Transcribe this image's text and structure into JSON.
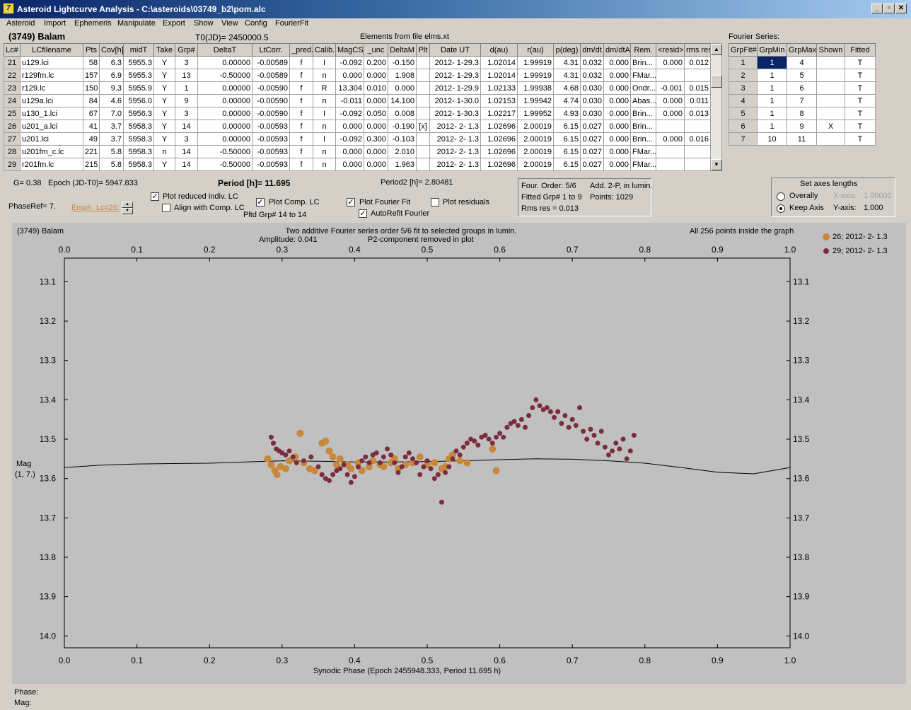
{
  "window": {
    "title": "Asteroid Lightcurve Analysis - C:\\asteroids\\03749_b2\\pom.alc",
    "icon_letter": "7"
  },
  "menu": [
    "Asteroid",
    "Import",
    "Ephemeris",
    "Manipulate",
    "Export",
    "Show",
    "View",
    "Config",
    "FourierFit"
  ],
  "header": {
    "object": "(3749) Balam",
    "t0": "T0(JD)= 2450000.5",
    "elements": "Elements from file elms.xt",
    "fourier_series": "Fourier Series:"
  },
  "lc_table": {
    "columns": [
      "Lc#",
      "LCfilename",
      "Pts",
      "Cov[h]",
      "midT",
      "Take",
      "Grp#",
      "DeltaT",
      "LtCorr.",
      "_pred.",
      "Calib.",
      "MagCS",
      "_unc",
      "DeltaM",
      "Plt",
      "Date UT",
      "d(au)",
      "r(au)",
      "p(deg)",
      "dm/dt",
      "dm/dtA",
      "Rem.",
      "<resid>",
      "rms res"
    ],
    "rows": [
      [
        "21",
        "u129.lci",
        "58",
        "6.3",
        "5955.3",
        "Y",
        "3",
        "0.00000",
        "-0.00589",
        "f",
        "I",
        "-0.092",
        "0.200",
        "-0.150",
        "",
        "2012- 1-29.3",
        "1.02014",
        "1.99919",
        "4.31",
        "0.032",
        "0.000",
        "Brin...",
        "0.000",
        "0.012"
      ],
      [
        "22",
        "r129fm.lc",
        "157",
        "6.9",
        "5955.3",
        "Y",
        "13",
        "-0.50000",
        "-0.00589",
        "f",
        "n",
        "0.000",
        "0.000",
        "1.908",
        "",
        "2012- 1-29.3",
        "1.02014",
        "1.99919",
        "4.31",
        "0.032",
        "0.000",
        "FMar...",
        "",
        ""
      ],
      [
        "23",
        "r129.lc",
        "150",
        "9.3",
        "5955.9",
        "Y",
        "1",
        "0.00000",
        "-0.00590",
        "f",
        "R",
        "13.304",
        "0.010",
        "0.000",
        "",
        "2012- 1-29.9",
        "1.02133",
        "1.99938",
        "4.68",
        "0.030",
        "0.000",
        "Ondr...",
        "-0.001",
        "0.015"
      ],
      [
        "24",
        "u129a.lci",
        "84",
        "4.6",
        "5956.0",
        "Y",
        "9",
        "0.00000",
        "-0.00590",
        "f",
        "n",
        "-0.011",
        "0.000",
        "14.100",
        "",
        "2012- 1-30.0",
        "1.02153",
        "1.99942",
        "4.74",
        "0.030",
        "0.000",
        "Abas...",
        "0.000",
        "0.011"
      ],
      [
        "25",
        "u130_1.lci",
        "67",
        "7.0",
        "5956.3",
        "Y",
        "3",
        "0.00000",
        "-0.00590",
        "f",
        "I",
        "-0.092",
        "0.050",
        "0.008",
        "",
        "2012- 1-30.3",
        "1.02217",
        "1.99952",
        "4.93",
        "0.030",
        "0.000",
        "Brin...",
        "0.000",
        "0.013"
      ],
      [
        "26",
        "u201_a.lci",
        "41",
        "3.7",
        "5958.3",
        "Y",
        "14",
        "0.00000",
        "-0.00593",
        "f",
        "n",
        "0.000",
        "0.000",
        "-0.190",
        "[x]",
        "2012- 2- 1.3",
        "1.02696",
        "2.00019",
        "6.15",
        "0.027",
        "0.000",
        "Brin...",
        "",
        ""
      ],
      [
        "27",
        "u201.lci",
        "49",
        "3.7",
        "5958.3",
        "Y",
        "3",
        "0.00000",
        "-0.00593",
        "f",
        "I",
        "-0.092",
        "0.300",
        "-0.103",
        "",
        "2012- 2- 1.3",
        "1.02696",
        "2.00019",
        "6.15",
        "0.027",
        "0.000",
        "Brin...",
        "0.000",
        "0.016"
      ],
      [
        "28",
        "u201fm_c.lc",
        "221",
        "5.8",
        "5958.3",
        "n",
        "14",
        "-0.50000",
        "-0.00593",
        "f",
        "n",
        "0.000",
        "0.000",
        "2.010",
        "",
        "2012- 2- 1.3",
        "1.02696",
        "2.00019",
        "6.15",
        "0.027",
        "0.000",
        "FMar...",
        "",
        ""
      ],
      [
        "29",
        "r201fm.lc",
        "215",
        "5.8",
        "5958.3",
        "Y",
        "14",
        "-0.50000",
        "-0.00593",
        "f",
        "n",
        "0.000",
        "0.000",
        "1.963",
        "",
        "2012- 2- 1.3",
        "1.02696",
        "2.00019",
        "6.15",
        "0.027",
        "0.000",
        "FMar...",
        "",
        ""
      ]
    ]
  },
  "fourier_table": {
    "columns": [
      "GrpFit#",
      "GrpMin",
      "GrpMax",
      "Shown",
      "Fitted"
    ],
    "rows": [
      [
        "1",
        "1",
        "4",
        "",
        "T"
      ],
      [
        "2",
        "1",
        "5",
        "",
        "T"
      ],
      [
        "3",
        "1",
        "6",
        "",
        "T"
      ],
      [
        "4",
        "1",
        "7",
        "",
        "T"
      ],
      [
        "5",
        "1",
        "8",
        "",
        "T"
      ],
      [
        "6",
        "1",
        "9",
        "X",
        "T"
      ],
      [
        "7",
        "10",
        "11",
        "",
        "T"
      ]
    ]
  },
  "controls": {
    "g": "G= 0.38",
    "epoch": "Epoch (JD-T0)= 5947.833",
    "period": "Period [h]= 11.695",
    "period2": "Period2 [h]= 2.80481",
    "phase_ref": "PhaseRef= 7.",
    "emph": "Emph. Lc#26:",
    "plot_reduced": "Plot reduced indiv. LC",
    "align_comp": "Align with Comp. LC",
    "plot_comp": "Plot Comp. LC",
    "pltd_grp": "Pltd Grp#  14 to   14",
    "plot_fourier": "Plot Fourier Fit",
    "autorefit": "AutoRefit Fourier",
    "plot_residuals": "Plot residuals"
  },
  "fit_info": {
    "order": "Four. Order:  5/6",
    "add": "Add. 2-P, in lumin.",
    "fitted": "Fitted Grp# 1 to 9",
    "points": "Points: 1029",
    "rms": "Rms res     = 0.013"
  },
  "axes_panel": {
    "title": "Set axes lengths",
    "overally": "Overally",
    "keep_axis": "Keep Axis",
    "x_label": "X-axis:",
    "x_val": "1.00000",
    "y_label": "Y-axis:",
    "y_val": "1.000"
  },
  "plot_texts": {
    "object": "(3749) Balam",
    "center1": "Two additive Fourier series order 5/6 fit to selected groups in lumin.",
    "amp": "Amplitude: 0.041",
    "p2": "P2-component removed in plot",
    "inside": "All 256 points inside the graph",
    "xlabel": "Synodic Phase (Epoch 2455948.333, Period 11.695 h)",
    "ylabel1": "Mag",
    "ylabel2": "(1, 7.)"
  },
  "status": {
    "phase": "Phase:",
    "mag": "Mag:"
  },
  "colors": {
    "series_a": "#c8873a",
    "series_b": "#7b2d3e",
    "plot_bg": "#c0c0c0",
    "link": "#c8873a"
  },
  "chart_data": {
    "type": "scatter",
    "x_ticks": [
      "0.0",
      "0.1",
      "0.2",
      "0.3",
      "0.4",
      "0.5",
      "0.6",
      "0.7",
      "0.8",
      "0.9",
      "1.0"
    ],
    "y_ticks": [
      "13.1",
      "13.2",
      "13.3",
      "13.4",
      "13.5",
      "13.6",
      "13.7",
      "13.8",
      "13.9",
      "14.0"
    ],
    "xlim": [
      0.0,
      1.0
    ],
    "ylim": [
      14.03,
      13.04
    ],
    "legend": [
      "26; 2012- 2- 1.3",
      "29; 2012- 2- 1.3"
    ],
    "fourier_curve": [
      [
        0.0,
        13.572
      ],
      [
        0.05,
        13.566
      ],
      [
        0.1,
        13.563
      ],
      [
        0.15,
        13.562
      ],
      [
        0.2,
        13.561
      ],
      [
        0.25,
        13.558
      ],
      [
        0.3,
        13.555
      ],
      [
        0.35,
        13.556
      ],
      [
        0.4,
        13.558
      ],
      [
        0.45,
        13.558
      ],
      [
        0.5,
        13.557
      ],
      [
        0.55,
        13.555
      ],
      [
        0.6,
        13.552
      ],
      [
        0.65,
        13.55
      ],
      [
        0.7,
        13.551
      ],
      [
        0.75,
        13.555
      ],
      [
        0.8,
        13.561
      ],
      [
        0.85,
        13.572
      ],
      [
        0.9,
        13.584
      ],
      [
        0.95,
        13.588
      ],
      [
        1.0,
        13.572
      ]
    ],
    "series": [
      {
        "name": "26; 2012- 2- 1.3",
        "points": [
          [
            0.28,
            13.55
          ],
          [
            0.285,
            13.565
          ],
          [
            0.29,
            13.58
          ],
          [
            0.293,
            13.59
          ],
          [
            0.298,
            13.57
          ],
          [
            0.305,
            13.575
          ],
          [
            0.31,
            13.555
          ],
          [
            0.318,
            13.545
          ],
          [
            0.325,
            13.485
          ],
          [
            0.33,
            13.56
          ],
          [
            0.338,
            13.575
          ],
          [
            0.345,
            13.58
          ],
          [
            0.355,
            13.51
          ],
          [
            0.36,
            13.505
          ],
          [
            0.365,
            13.53
          ],
          [
            0.37,
            13.545
          ],
          [
            0.375,
            13.565
          ],
          [
            0.38,
            13.55
          ],
          [
            0.39,
            13.565
          ],
          [
            0.395,
            13.575
          ],
          [
            0.405,
            13.56
          ],
          [
            0.41,
            13.58
          ],
          [
            0.42,
            13.57
          ],
          [
            0.425,
            13.555
          ],
          [
            0.435,
            13.565
          ],
          [
            0.44,
            13.57
          ],
          [
            0.45,
            13.56
          ],
          [
            0.455,
            13.55
          ],
          [
            0.46,
            13.575
          ],
          [
            0.47,
            13.565
          ],
          [
            0.48,
            13.56
          ],
          [
            0.49,
            13.545
          ],
          [
            0.5,
            13.565
          ],
          [
            0.51,
            13.56
          ],
          [
            0.52,
            13.575
          ],
          [
            0.525,
            13.57
          ],
          [
            0.53,
            13.55
          ],
          [
            0.535,
            13.54
          ],
          [
            0.545,
            13.555
          ],
          [
            0.555,
            13.56
          ],
          [
            0.59,
            13.525
          ],
          [
            0.595,
            13.58
          ]
        ]
      },
      {
        "name": "29; 2012- 2- 1.3",
        "points": [
          [
            0.285,
            13.495
          ],
          [
            0.288,
            13.51
          ],
          [
            0.292,
            13.525
          ],
          [
            0.296,
            13.53
          ],
          [
            0.3,
            13.535
          ],
          [
            0.305,
            13.54
          ],
          [
            0.31,
            13.53
          ],
          [
            0.315,
            13.545
          ],
          [
            0.32,
            13.56
          ],
          [
            0.33,
            13.555
          ],
          [
            0.34,
            13.545
          ],
          [
            0.35,
            13.57
          ],
          [
            0.355,
            13.59
          ],
          [
            0.36,
            13.6
          ],
          [
            0.365,
            13.605
          ],
          [
            0.37,
            13.59
          ],
          [
            0.375,
            13.58
          ],
          [
            0.38,
            13.575
          ],
          [
            0.385,
            13.565
          ],
          [
            0.39,
            13.59
          ],
          [
            0.395,
            13.61
          ],
          [
            0.4,
            13.595
          ],
          [
            0.405,
            13.57
          ],
          [
            0.41,
            13.555
          ],
          [
            0.415,
            13.545
          ],
          [
            0.42,
            13.56
          ],
          [
            0.425,
            13.54
          ],
          [
            0.43,
            13.535
          ],
          [
            0.435,
            13.56
          ],
          [
            0.44,
            13.545
          ],
          [
            0.445,
            13.525
          ],
          [
            0.45,
            13.54
          ],
          [
            0.455,
            13.56
          ],
          [
            0.46,
            13.585
          ],
          [
            0.465,
            13.57
          ],
          [
            0.47,
            13.545
          ],
          [
            0.475,
            13.535
          ],
          [
            0.48,
            13.55
          ],
          [
            0.485,
            13.56
          ],
          [
            0.49,
            13.59
          ],
          [
            0.495,
            13.57
          ],
          [
            0.5,
            13.555
          ],
          [
            0.505,
            13.575
          ],
          [
            0.51,
            13.6
          ],
          [
            0.515,
            13.59
          ],
          [
            0.52,
            13.66
          ],
          [
            0.525,
            13.585
          ],
          [
            0.53,
            13.57
          ],
          [
            0.535,
            13.55
          ],
          [
            0.54,
            13.53
          ],
          [
            0.545,
            13.54
          ],
          [
            0.55,
            13.52
          ],
          [
            0.555,
            13.51
          ],
          [
            0.56,
            13.5
          ],
          [
            0.565,
            13.505
          ],
          [
            0.57,
            13.515
          ],
          [
            0.575,
            13.495
          ],
          [
            0.58,
            13.49
          ],
          [
            0.585,
            13.5
          ],
          [
            0.59,
            13.51
          ],
          [
            0.595,
            13.495
          ],
          [
            0.6,
            13.485
          ],
          [
            0.605,
            13.495
          ],
          [
            0.61,
            13.47
          ],
          [
            0.615,
            13.46
          ],
          [
            0.62,
            13.455
          ],
          [
            0.625,
            13.465
          ],
          [
            0.63,
            13.45
          ],
          [
            0.635,
            13.47
          ],
          [
            0.64,
            13.44
          ],
          [
            0.645,
            13.42
          ],
          [
            0.65,
            13.4
          ],
          [
            0.655,
            13.415
          ],
          [
            0.66,
            13.425
          ],
          [
            0.665,
            13.42
          ],
          [
            0.67,
            13.43
          ],
          [
            0.675,
            13.445
          ],
          [
            0.68,
            13.43
          ],
          [
            0.685,
            13.46
          ],
          [
            0.69,
            13.44
          ],
          [
            0.695,
            13.47
          ],
          [
            0.7,
            13.45
          ],
          [
            0.705,
            13.465
          ],
          [
            0.71,
            13.42
          ],
          [
            0.715,
            13.48
          ],
          [
            0.72,
            13.5
          ],
          [
            0.725,
            13.475
          ],
          [
            0.73,
            13.49
          ],
          [
            0.735,
            13.51
          ],
          [
            0.74,
            13.48
          ],
          [
            0.745,
            13.52
          ],
          [
            0.75,
            13.54
          ],
          [
            0.755,
            13.53
          ],
          [
            0.76,
            13.51
          ],
          [
            0.765,
            13.525
          ],
          [
            0.77,
            13.5
          ],
          [
            0.775,
            13.55
          ],
          [
            0.78,
            13.53
          ],
          [
            0.785,
            13.49
          ]
        ]
      }
    ]
  }
}
